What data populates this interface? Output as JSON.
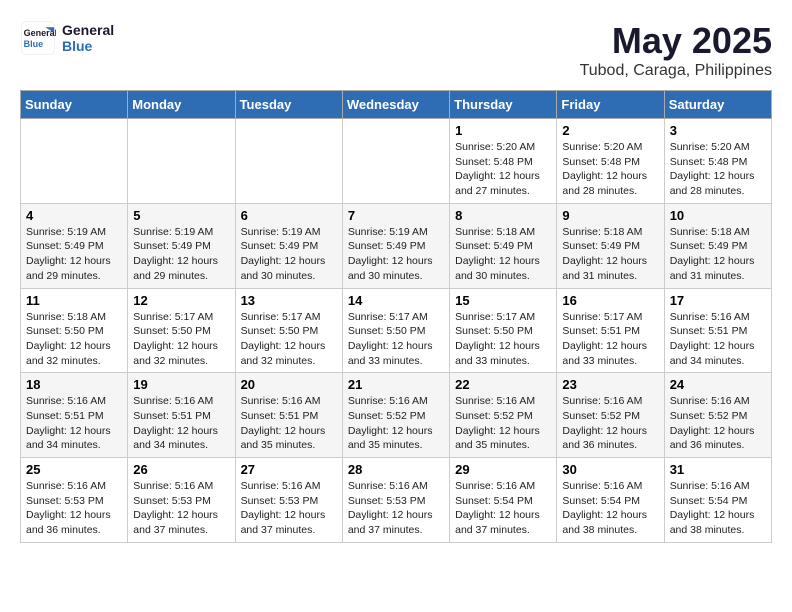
{
  "logo": {
    "line1": "General",
    "line2": "Blue"
  },
  "title": "May 2025",
  "location": "Tubod, Caraga, Philippines",
  "weekdays": [
    "Sunday",
    "Monday",
    "Tuesday",
    "Wednesday",
    "Thursday",
    "Friday",
    "Saturday"
  ],
  "weeks": [
    [
      {
        "day": "",
        "info": ""
      },
      {
        "day": "",
        "info": ""
      },
      {
        "day": "",
        "info": ""
      },
      {
        "day": "",
        "info": ""
      },
      {
        "day": "1",
        "info": "Sunrise: 5:20 AM\nSunset: 5:48 PM\nDaylight: 12 hours\nand 27 minutes."
      },
      {
        "day": "2",
        "info": "Sunrise: 5:20 AM\nSunset: 5:48 PM\nDaylight: 12 hours\nand 28 minutes."
      },
      {
        "day": "3",
        "info": "Sunrise: 5:20 AM\nSunset: 5:48 PM\nDaylight: 12 hours\nand 28 minutes."
      }
    ],
    [
      {
        "day": "4",
        "info": "Sunrise: 5:19 AM\nSunset: 5:49 PM\nDaylight: 12 hours\nand 29 minutes."
      },
      {
        "day": "5",
        "info": "Sunrise: 5:19 AM\nSunset: 5:49 PM\nDaylight: 12 hours\nand 29 minutes."
      },
      {
        "day": "6",
        "info": "Sunrise: 5:19 AM\nSunset: 5:49 PM\nDaylight: 12 hours\nand 30 minutes."
      },
      {
        "day": "7",
        "info": "Sunrise: 5:19 AM\nSunset: 5:49 PM\nDaylight: 12 hours\nand 30 minutes."
      },
      {
        "day": "8",
        "info": "Sunrise: 5:18 AM\nSunset: 5:49 PM\nDaylight: 12 hours\nand 30 minutes."
      },
      {
        "day": "9",
        "info": "Sunrise: 5:18 AM\nSunset: 5:49 PM\nDaylight: 12 hours\nand 31 minutes."
      },
      {
        "day": "10",
        "info": "Sunrise: 5:18 AM\nSunset: 5:49 PM\nDaylight: 12 hours\nand 31 minutes."
      }
    ],
    [
      {
        "day": "11",
        "info": "Sunrise: 5:18 AM\nSunset: 5:50 PM\nDaylight: 12 hours\nand 32 minutes."
      },
      {
        "day": "12",
        "info": "Sunrise: 5:17 AM\nSunset: 5:50 PM\nDaylight: 12 hours\nand 32 minutes."
      },
      {
        "day": "13",
        "info": "Sunrise: 5:17 AM\nSunset: 5:50 PM\nDaylight: 12 hours\nand 32 minutes."
      },
      {
        "day": "14",
        "info": "Sunrise: 5:17 AM\nSunset: 5:50 PM\nDaylight: 12 hours\nand 33 minutes."
      },
      {
        "day": "15",
        "info": "Sunrise: 5:17 AM\nSunset: 5:50 PM\nDaylight: 12 hours\nand 33 minutes."
      },
      {
        "day": "16",
        "info": "Sunrise: 5:17 AM\nSunset: 5:51 PM\nDaylight: 12 hours\nand 33 minutes."
      },
      {
        "day": "17",
        "info": "Sunrise: 5:16 AM\nSunset: 5:51 PM\nDaylight: 12 hours\nand 34 minutes."
      }
    ],
    [
      {
        "day": "18",
        "info": "Sunrise: 5:16 AM\nSunset: 5:51 PM\nDaylight: 12 hours\nand 34 minutes."
      },
      {
        "day": "19",
        "info": "Sunrise: 5:16 AM\nSunset: 5:51 PM\nDaylight: 12 hours\nand 34 minutes."
      },
      {
        "day": "20",
        "info": "Sunrise: 5:16 AM\nSunset: 5:51 PM\nDaylight: 12 hours\nand 35 minutes."
      },
      {
        "day": "21",
        "info": "Sunrise: 5:16 AM\nSunset: 5:52 PM\nDaylight: 12 hours\nand 35 minutes."
      },
      {
        "day": "22",
        "info": "Sunrise: 5:16 AM\nSunset: 5:52 PM\nDaylight: 12 hours\nand 35 minutes."
      },
      {
        "day": "23",
        "info": "Sunrise: 5:16 AM\nSunset: 5:52 PM\nDaylight: 12 hours\nand 36 minutes."
      },
      {
        "day": "24",
        "info": "Sunrise: 5:16 AM\nSunset: 5:52 PM\nDaylight: 12 hours\nand 36 minutes."
      }
    ],
    [
      {
        "day": "25",
        "info": "Sunrise: 5:16 AM\nSunset: 5:53 PM\nDaylight: 12 hours\nand 36 minutes."
      },
      {
        "day": "26",
        "info": "Sunrise: 5:16 AM\nSunset: 5:53 PM\nDaylight: 12 hours\nand 37 minutes."
      },
      {
        "day": "27",
        "info": "Sunrise: 5:16 AM\nSunset: 5:53 PM\nDaylight: 12 hours\nand 37 minutes."
      },
      {
        "day": "28",
        "info": "Sunrise: 5:16 AM\nSunset: 5:53 PM\nDaylight: 12 hours\nand 37 minutes."
      },
      {
        "day": "29",
        "info": "Sunrise: 5:16 AM\nSunset: 5:54 PM\nDaylight: 12 hours\nand 37 minutes."
      },
      {
        "day": "30",
        "info": "Sunrise: 5:16 AM\nSunset: 5:54 PM\nDaylight: 12 hours\nand 38 minutes."
      },
      {
        "day": "31",
        "info": "Sunrise: 5:16 AM\nSunset: 5:54 PM\nDaylight: 12 hours\nand 38 minutes."
      }
    ]
  ]
}
